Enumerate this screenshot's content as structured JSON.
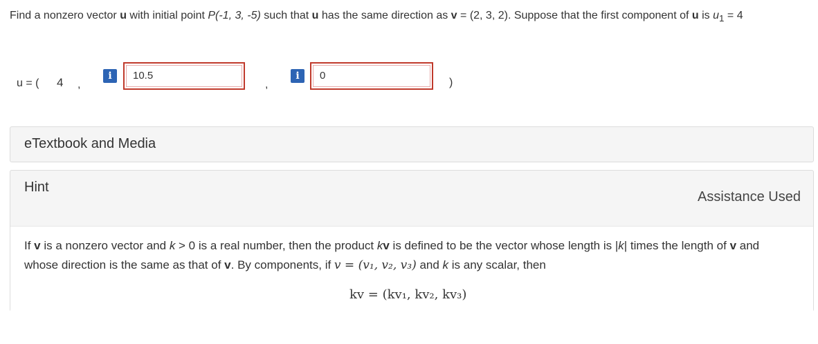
{
  "question": {
    "part1": "Find a nonzero vector ",
    "u": "u",
    "part2": " with initial point ",
    "point": "P(-1, 3, -5)",
    "part3": " such that ",
    "part4": " has the same direction as ",
    "v": "v",
    "part5": " = (2, 3, 2). Suppose that the first component of ",
    "part6": " is ",
    "u1": "u",
    "u1_sub": "1",
    "part7": " = 4"
  },
  "answer": {
    "label": "u = (",
    "component1": "4",
    "comma": ",",
    "component2_value": "10.5",
    "component3_value": "0",
    "close": ")",
    "info_icon": "i"
  },
  "etextbook": {
    "title": "eTextbook and Media"
  },
  "hint": {
    "title": "Hint",
    "status": "Assistance Used",
    "t1": "If ",
    "v": "v",
    "t2": " is a nonzero vector and ",
    "k": "k",
    "t3": " > 0 is a real number, then the product ",
    "kv": "kv",
    "t4": " is defined to be the vector whose length is |",
    "t5": "| times the length of ",
    "t6": " and whose direction is the same as that of ",
    "t7": ". By components, if ",
    "veq": "v = (v₁, v₂, v₃)",
    "t8": " and ",
    "t9": " is any scalar, then",
    "formula": "kv = (kv₁, kv₂, kv₃)"
  },
  "colors": {
    "icon_blue": "#2d64b4",
    "error_red": "#c0392b",
    "panel_gray": "#f5f5f5"
  }
}
